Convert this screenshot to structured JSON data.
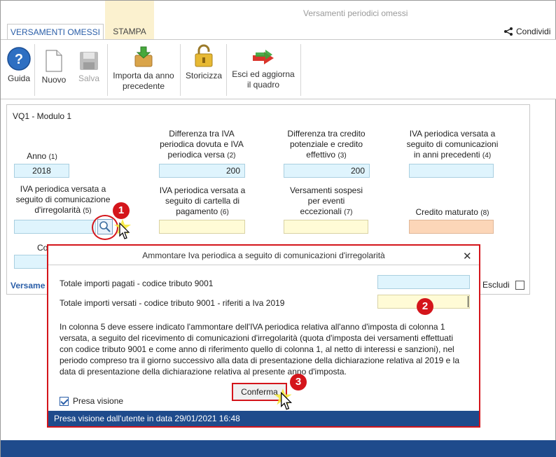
{
  "window": {
    "title": "Versamenti periodici omessi"
  },
  "tabs": [
    {
      "label": "VERSAMENTI OMESSI"
    },
    {
      "label": "STAMPA"
    }
  ],
  "share_label": "Condividi",
  "ribbon": {
    "guida": "Guida",
    "nuovo": "Nuovo",
    "salva": "Salva",
    "importa": [
      "Importa da anno",
      "precedente"
    ],
    "storicizza": "Storicizza",
    "esci": [
      "Esci ed aggiorna",
      "il quadro"
    ]
  },
  "module_title": "VQ1 - Modulo 1",
  "fields": {
    "anno": {
      "label": "Anno",
      "num": "(1)",
      "value": "2018"
    },
    "diff_iva": {
      "label_lines": [
        "Differenza tra IVA",
        "periodica dovuta e IVA",
        "periodica versa"
      ],
      "num": "(2)",
      "value": "200"
    },
    "diff_credito": {
      "label_lines": [
        "Differenza tra credito",
        "potenziale e credito",
        "effettivo"
      ],
      "num": "(3)",
      "value": "200"
    },
    "iva_prec": {
      "label_lines": [
        "IVA periodica versata a",
        "seguito di comunicazioni",
        "in anni precedenti"
      ],
      "num": "(4)",
      "value": ""
    },
    "iva_irreg": {
      "label_lines": [
        "IVA periodica versata a",
        "seguito di comunicazione",
        "d'irregolarità"
      ],
      "num": "(5)",
      "value": ""
    },
    "iva_cartella": {
      "label_lines": [
        "IVA periodica versata a",
        "seguito di cartella di",
        "pagamento"
      ],
      "num": "(6)",
      "value": ""
    },
    "sospesi": {
      "label_lines": [
        "Versamenti sospesi",
        "per eventi",
        "eccezionali"
      ],
      "num": "(7)",
      "value": ""
    },
    "credito": {
      "label": "Credito maturato",
      "num": "(8)",
      "value": ""
    }
  },
  "partial_label_co": "Co",
  "versamenti_label": "Versame",
  "escludi_label": "Escludi",
  "callouts": [
    "1",
    "2",
    "3"
  ],
  "dialog": {
    "title": "Ammontare Iva periodica a seguito di comunicazioni d'irregolarità",
    "close": "✕",
    "row1_label": "Totale importi pagati - codice tributo 9001",
    "row1_value": "",
    "row2_label": "Totale importi versati - codice tributo 9001 - riferiti a Iva 2019",
    "row2_value": "",
    "text_lines": [
      "In colonna 5 deve essere indicato l'ammontare dell'IVA periodica relativa all'anno d'imposta di colonna 1",
      "versata, a seguito del ricevimento di comunicazioni d'irregolarità (quota d'imposta dei versamenti effettuati",
      "con codice tributo 9001 e come anno di riferimento quello di colonna 1, al netto di interessi e sanzioni), nel",
      "periodo compreso tra il giorno successivo alla data di presentazione della dichiarazione relativa al 2019 e la",
      "data di presentazione della dichiarazione relativa al presente anno d'imposta."
    ],
    "confirm_label": "Conferma",
    "presa_visione_label": "Presa visione",
    "status": "Presa visione dall'utente in data 29/01/2021 16:48"
  }
}
